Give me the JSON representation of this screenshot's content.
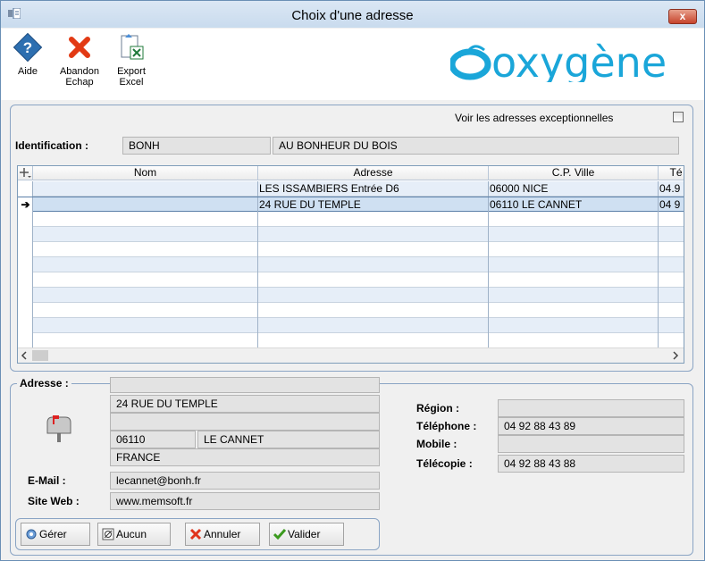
{
  "window": {
    "title": "Choix d'une adresse",
    "close_label": "x"
  },
  "toolbar": {
    "buttons": [
      {
        "label1": "Aide",
        "label2": "",
        "icon": "help-icon"
      },
      {
        "label1": "Abandon",
        "label2": "Echap",
        "icon": "cancel-x-icon"
      },
      {
        "label1": "Export",
        "label2": "Excel",
        "icon": "excel-export-icon"
      }
    ],
    "logo": "oxygène"
  },
  "top_panel": {
    "exceptional_label": "Voir les adresses exceptionnelles",
    "exceptional_checked": false,
    "identification_label": "Identification :",
    "identification_code": "BONH",
    "identification_name": "AU BONHEUR DU BOIS"
  },
  "grid": {
    "columns": [
      "",
      "Nom",
      "Adresse",
      "C.P. Ville",
      "Té"
    ],
    "rows": [
      {
        "marker": "",
        "nom": "",
        "adresse": "LES ISSAMBIERS Entrée D6",
        "cp_ville": "06000 NICE",
        "tel": "04.9"
      },
      {
        "marker": "➔",
        "nom": "",
        "adresse": "24 RUE DU TEMPLE",
        "cp_ville": "06110 LE CANNET",
        "tel": "04 9"
      }
    ],
    "selected_row": 1,
    "empty_rows": 9
  },
  "address": {
    "section_label": "Adresse :",
    "line1": "",
    "line2": "24 RUE DU TEMPLE",
    "line3": "",
    "postal_code": "06110",
    "city": "LE CANNET",
    "country": "FRANCE",
    "email_label": "E-Mail :",
    "email": "lecannet@bonh.fr",
    "website_label": "Site Web :",
    "website": "www.memsoft.fr",
    "region_label": "Région :",
    "region": "",
    "phone_label": "Téléphone :",
    "phone": "04 92 88 43 89",
    "mobile_label": "Mobile :",
    "mobile": "",
    "fax_label": "Télécopie :",
    "fax": "04 92 88 43 88"
  },
  "buttons": {
    "manage": "Gérer",
    "none": "Aucun",
    "cancel": "Annuler",
    "validate": "Valider"
  },
  "colors": {
    "accent": "#1aa6d9",
    "selected_row": "#cfe0f2",
    "alt_row": "#e6eef8"
  }
}
